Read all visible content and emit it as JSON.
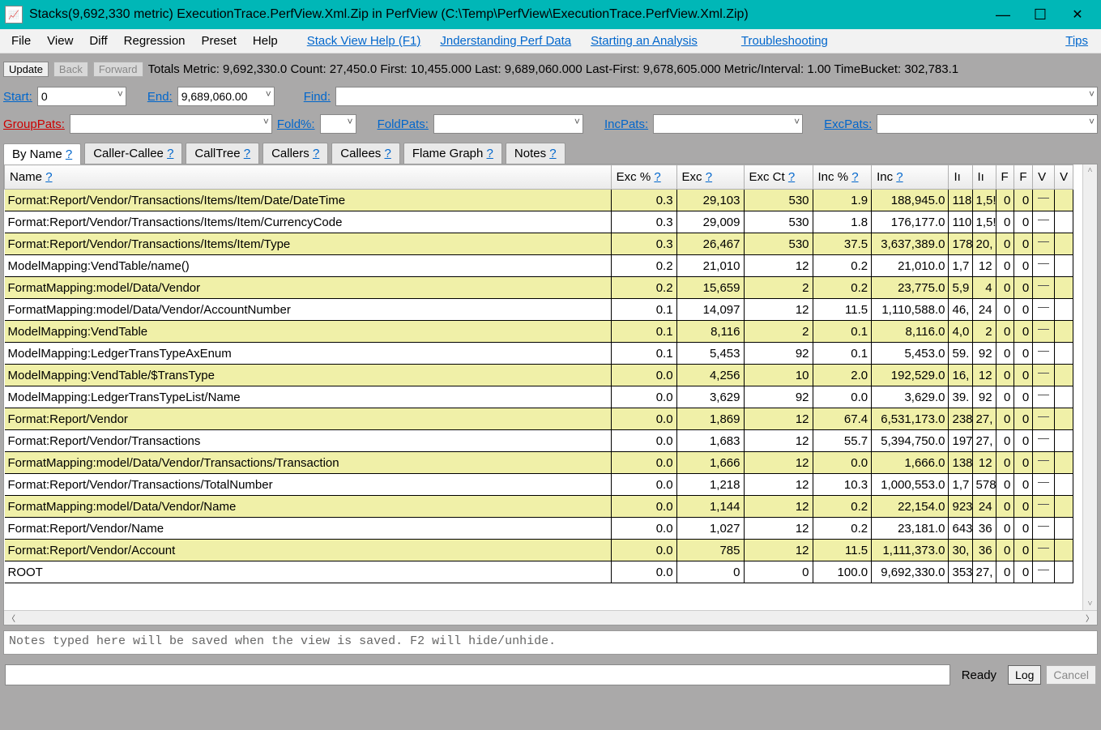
{
  "window": {
    "title": "Stacks(9,692,330 metric) ExecutionTrace.PerfView.Xml.Zip in PerfView (C:\\Temp\\PerfView\\ExecutionTrace.PerfView.Xml.Zip)",
    "minimize": "—",
    "maximize": "☐",
    "close": "✕"
  },
  "menu": {
    "file": "File",
    "view": "View",
    "diff": "Diff",
    "regression": "Regression",
    "preset": "Preset",
    "help": "Help",
    "stack_help": "Stack View Help (F1)",
    "understanding": "Jnderstanding Perf Data",
    "starting": "Starting an Analysis",
    "troubleshooting": "Troubleshooting",
    "tips": "Tips"
  },
  "toolbar": {
    "update": "Update",
    "back": "Back",
    "forward": "Forward",
    "totals": "Totals Metric: 9,692,330.0   Count: 27,450.0   First: 10,455.000 Last: 9,689,060.000   Last-First: 9,678,605.000   Metric/Interval: 1.00   TimeBucket: 302,783.1",
    "start_label": "Start:",
    "start_value": "0",
    "end_label": "End:",
    "end_value": "9,689,060.00",
    "find_label": "Find:",
    "grouppats_label": "GroupPats:",
    "foldpct_label": "Fold%:",
    "foldpats_label": "FoldPats:",
    "incpats_label": "IncPats:",
    "excpats_label": "ExcPats:"
  },
  "tabs": {
    "byname": "By Name",
    "callercallee": "Caller-Callee",
    "calltree": "CallTree",
    "callers": "Callers",
    "callees": "Callees",
    "flame": "Flame Graph",
    "notes": "Notes",
    "q": "?"
  },
  "columns": {
    "name": "Name",
    "excpct": "Exc %",
    "exc": "Exc",
    "excct": "Exc Ct",
    "incpct": "Inc %",
    "inc": "Inc",
    "c6": "Iı",
    "c7": "Iı",
    "c8": "F",
    "c9": "F",
    "c10": "V",
    "c11": "V",
    "q": "?"
  },
  "rows": [
    {
      "hl": true,
      "name": "Format:Report/Vendor/Transactions/Items/Item/Date/DateTime",
      "excpct": "0.3",
      "exc": "29,103",
      "excct": "530",
      "incpct": "1.9",
      "inc": "188,945.0",
      "c6": "118",
      "c7": "1,5!",
      "c8": "0",
      "c9": "0"
    },
    {
      "hl": false,
      "name": "Format:Report/Vendor/Transactions/Items/Item/CurrencyCode",
      "excpct": "0.3",
      "exc": "29,009",
      "excct": "530",
      "incpct": "1.8",
      "inc": "176,177.0",
      "c6": "110",
      "c7": "1,5!",
      "c8": "0",
      "c9": "0"
    },
    {
      "hl": true,
      "name": "Format:Report/Vendor/Transactions/Items/Item/Type",
      "excpct": "0.3",
      "exc": "26,467",
      "excct": "530",
      "incpct": "37.5",
      "inc": "3,637,389.0",
      "c6": "178",
      "c7": "20,",
      "c8": "0",
      "c9": "0"
    },
    {
      "hl": false,
      "name": "ModelMapping:VendTable/name()",
      "excpct": "0.2",
      "exc": "21,010",
      "excct": "12",
      "incpct": "0.2",
      "inc": "21,010.0",
      "c6": "1,7",
      "c7": "12",
      "c8": "0",
      "c9": "0"
    },
    {
      "hl": true,
      "name": "FormatMapping:model/Data/Vendor",
      "excpct": "0.2",
      "exc": "15,659",
      "excct": "2",
      "incpct": "0.2",
      "inc": "23,775.0",
      "c6": "5,9",
      "c7": "4",
      "c8": "0",
      "c9": "0"
    },
    {
      "hl": false,
      "name": "FormatMapping:model/Data/Vendor/AccountNumber",
      "excpct": "0.1",
      "exc": "14,097",
      "excct": "12",
      "incpct": "11.5",
      "inc": "1,110,588.0",
      "c6": "46,",
      "c7": "24",
      "c8": "0",
      "c9": "0"
    },
    {
      "hl": true,
      "name": "ModelMapping:VendTable",
      "excpct": "0.1",
      "exc": "8,116",
      "excct": "2",
      "incpct": "0.1",
      "inc": "8,116.0",
      "c6": "4,0",
      "c7": "2",
      "c8": "0",
      "c9": "0"
    },
    {
      "hl": false,
      "name": "ModelMapping:LedgerTransTypeAxEnum",
      "excpct": "0.1",
      "exc": "5,453",
      "excct": "92",
      "incpct": "0.1",
      "inc": "5,453.0",
      "c6": "59.",
      "c7": "92",
      "c8": "0",
      "c9": "0"
    },
    {
      "hl": true,
      "name": "ModelMapping:VendTable/$TransType",
      "excpct": "0.0",
      "exc": "4,256",
      "excct": "10",
      "incpct": "2.0",
      "inc": "192,529.0",
      "c6": "16,",
      "c7": "12",
      "c8": "0",
      "c9": "0"
    },
    {
      "hl": false,
      "name": "ModelMapping:LedgerTransTypeList/Name",
      "excpct": "0.0",
      "exc": "3,629",
      "excct": "92",
      "incpct": "0.0",
      "inc": "3,629.0",
      "c6": "39.",
      "c7": "92",
      "c8": "0",
      "c9": "0"
    },
    {
      "hl": true,
      "name": "Format:Report/Vendor",
      "excpct": "0.0",
      "exc": "1,869",
      "excct": "12",
      "incpct": "67.4",
      "inc": "6,531,173.0",
      "c6": "238",
      "c7": "27,",
      "c8": "0",
      "c9": "0"
    },
    {
      "hl": false,
      "name": "Format:Report/Vendor/Transactions",
      "excpct": "0.0",
      "exc": "1,683",
      "excct": "12",
      "incpct": "55.7",
      "inc": "5,394,750.0",
      "c6": "197",
      "c7": "27,",
      "c8": "0",
      "c9": "0"
    },
    {
      "hl": true,
      "name": "FormatMapping:model/Data/Vendor/Transactions/Transaction",
      "excpct": "0.0",
      "exc": "1,666",
      "excct": "12",
      "incpct": "0.0",
      "inc": "1,666.0",
      "c6": "138",
      "c7": "12",
      "c8": "0",
      "c9": "0"
    },
    {
      "hl": false,
      "name": "Format:Report/Vendor/Transactions/TotalNumber",
      "excpct": "0.0",
      "exc": "1,218",
      "excct": "12",
      "incpct": "10.3",
      "inc": "1,000,553.0",
      "c6": "1,7",
      "c7": "578",
      "c8": "0",
      "c9": "0"
    },
    {
      "hl": true,
      "name": "FormatMapping:model/Data/Vendor/Name",
      "excpct": "0.0",
      "exc": "1,144",
      "excct": "12",
      "incpct": "0.2",
      "inc": "22,154.0",
      "c6": "923",
      "c7": "24",
      "c8": "0",
      "c9": "0"
    },
    {
      "hl": false,
      "name": "Format:Report/Vendor/Name",
      "excpct": "0.0",
      "exc": "1,027",
      "excct": "12",
      "incpct": "0.2",
      "inc": "23,181.0",
      "c6": "643",
      "c7": "36",
      "c8": "0",
      "c9": "0"
    },
    {
      "hl": true,
      "name": "Format:Report/Vendor/Account",
      "excpct": "0.0",
      "exc": "785",
      "excct": "12",
      "incpct": "11.5",
      "inc": "1,111,373.0",
      "c6": "30,",
      "c7": "36",
      "c8": "0",
      "c9": "0"
    },
    {
      "hl": false,
      "name": "ROOT",
      "excpct": "0.0",
      "exc": "0",
      "excct": "0",
      "incpct": "100.0",
      "inc": "9,692,330.0",
      "c6": "353",
      "c7": "27,",
      "c8": "0",
      "c9": "0"
    }
  ],
  "notes_placeholder": "Notes typed here will be saved when the view is saved. F2 will hide/unhide.",
  "status": {
    "ready": "Ready",
    "log": "Log",
    "cancel": "Cancel"
  }
}
